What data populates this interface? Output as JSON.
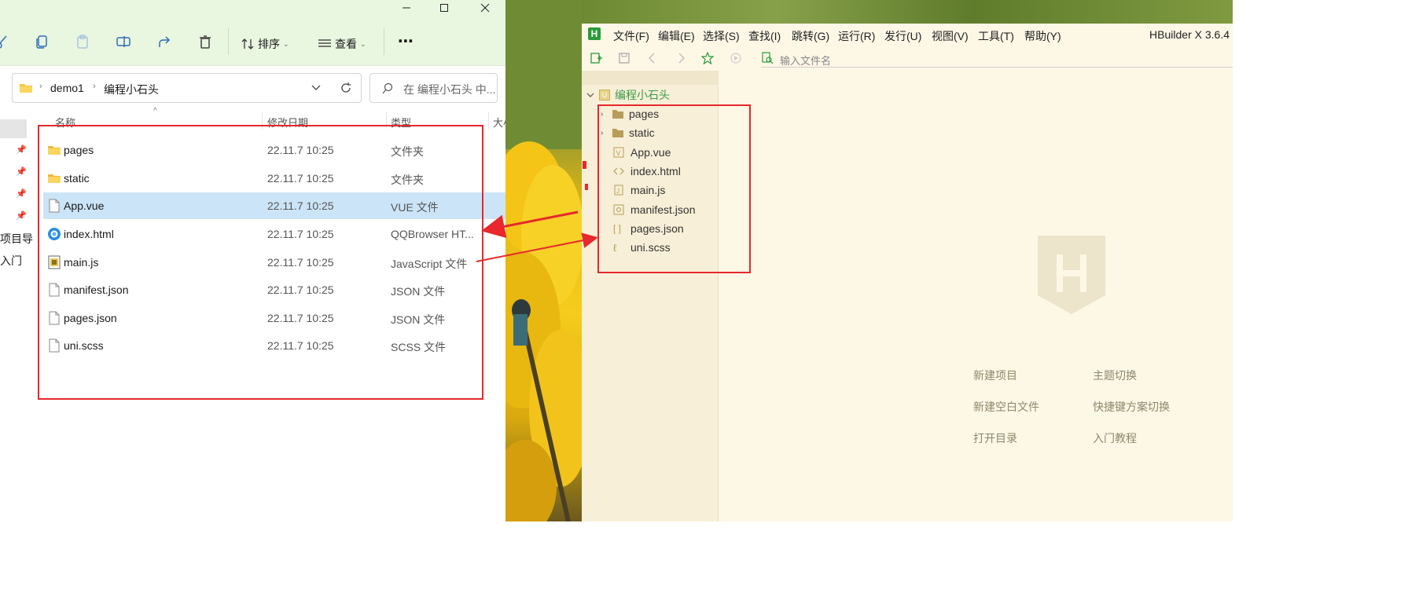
{
  "explorer": {
    "toolbar": {
      "sort_label": "排序",
      "view_label": "查看",
      "more_label": "⋯"
    },
    "breadcrumb": [
      "demo1",
      "编程小石头"
    ],
    "search_placeholder": "在 编程小石头 中...",
    "columns": {
      "name": "名称",
      "date": "修改日期",
      "type": "类型",
      "size": "大小"
    },
    "sidebar_items": [
      "项目导",
      "入门"
    ],
    "files": [
      {
        "name": "pages",
        "date": "22.11.7 10:25",
        "type": "文件夹",
        "icon": "folder-icon"
      },
      {
        "name": "static",
        "date": "22.11.7 10:25",
        "type": "文件夹",
        "icon": "folder-icon"
      },
      {
        "name": "App.vue",
        "date": "22.11.7 10:25",
        "type": "VUE 文件",
        "icon": "file-icon"
      },
      {
        "name": "index.html",
        "date": "22.11.7 10:25",
        "type": "QQBrowser HT...",
        "icon": "browser-icon"
      },
      {
        "name": "main.js",
        "date": "22.11.7 10:25",
        "type": "JavaScript 文件",
        "icon": "js-file-icon"
      },
      {
        "name": "manifest.json",
        "date": "22.11.7 10:25",
        "type": "JSON 文件",
        "icon": "file-icon"
      },
      {
        "name": "pages.json",
        "date": "22.11.7 10:25",
        "type": "JSON 文件",
        "icon": "file-icon"
      },
      {
        "name": "uni.scss",
        "date": "22.11.7 10:25",
        "type": "SCSS 文件",
        "icon": "file-icon"
      }
    ],
    "selected_file": "App.vue"
  },
  "hbuilder": {
    "app_title": "HBuilder X 3.6.4",
    "logo_letter": "H",
    "menu": [
      "文件(F)",
      "编辑(E)",
      "选择(S)",
      "查找(I)",
      "跳转(G)",
      "运行(R)",
      "发行(U)",
      "视图(V)",
      "工具(T)",
      "帮助(Y)"
    ],
    "file_input_placeholder": "输入文件名",
    "project_name": "编程小石头",
    "tree": [
      {
        "name": "pages",
        "icon": "folder-icon",
        "expandable": true
      },
      {
        "name": "static",
        "icon": "folder-icon",
        "expandable": true
      },
      {
        "name": "App.vue",
        "icon": "vue-file-icon",
        "expandable": false
      },
      {
        "name": "index.html",
        "icon": "html-file-icon",
        "expandable": false
      },
      {
        "name": "main.js",
        "icon": "js-file-icon",
        "expandable": false
      },
      {
        "name": "manifest.json",
        "icon": "manifest-file-icon",
        "expandable": false
      },
      {
        "name": "pages.json",
        "icon": "json-file-icon",
        "expandable": false
      },
      {
        "name": "uni.scss",
        "icon": "scss-file-icon",
        "expandable": false
      }
    ],
    "welcome_links": {
      "new_project": "新建项目",
      "new_blank_file": "新建空白文件",
      "open_directory": "打开目录",
      "switch_theme": "主题切换",
      "switch_keymap": "快捷键方案切换",
      "getting_started": "入门教程"
    }
  },
  "colors": {
    "annotation_red": "#e8282c",
    "hbuilder_green": "#2a9b3a",
    "selection_blue": "#cce4f7"
  }
}
